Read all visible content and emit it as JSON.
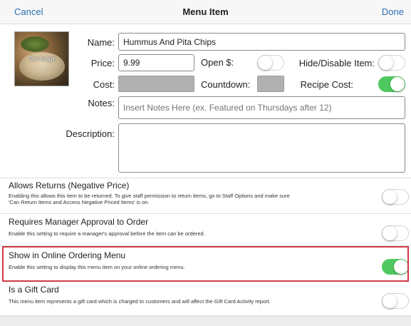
{
  "header": {
    "cancel_label": "Cancel",
    "title": "Menu Item",
    "done_label": "Done"
  },
  "photo": {
    "label": "Set Image"
  },
  "form": {
    "name_label": "Name:",
    "name_value": "Hummus And Pita Chips",
    "price_label": "Price:",
    "price_value": "9.99",
    "open_price_label": "Open $:",
    "open_price_on": false,
    "hide_label": "Hide/Disable Item:",
    "hide_on": false,
    "cost_label": "Cost:",
    "countdown_label": "Countdown:",
    "recipe_cost_label": "Recipe Cost:",
    "recipe_cost_on": true,
    "notes_label": "Notes:",
    "notes_placeholder": "Insert Notes Here (ex. Featured on Thursdays after 12)",
    "description_label": "Description:",
    "description_value": ""
  },
  "settings": [
    {
      "title": "Allows Returns (Negative Price)",
      "description_line1": "Enabling this allows this item to be returned. To give staff permission to return items, go to Staff Options and make sure",
      "description_line2": "'Can Return Items and Access Negative Priced Items' is on.",
      "on": false
    },
    {
      "title": "Requires Manager Approval to Order",
      "description_line1": "Enable this setting to require a manager's approval before the item can be ordered.",
      "on": false
    },
    {
      "title": "Show in Online Ordering Menu",
      "description_line1": "Enable this setting to display this menu item on your online ordering menu.",
      "on": true
    },
    {
      "title": "Is a Gift Card",
      "description_line1": "This menu item represents a gift card which is charged to customers and will affect the Gift Card Activity report.",
      "on": false
    }
  ],
  "colors": {
    "accent": "#2c6fb0",
    "toggle_on": "#4fc95f",
    "highlight": "#d23b46"
  }
}
